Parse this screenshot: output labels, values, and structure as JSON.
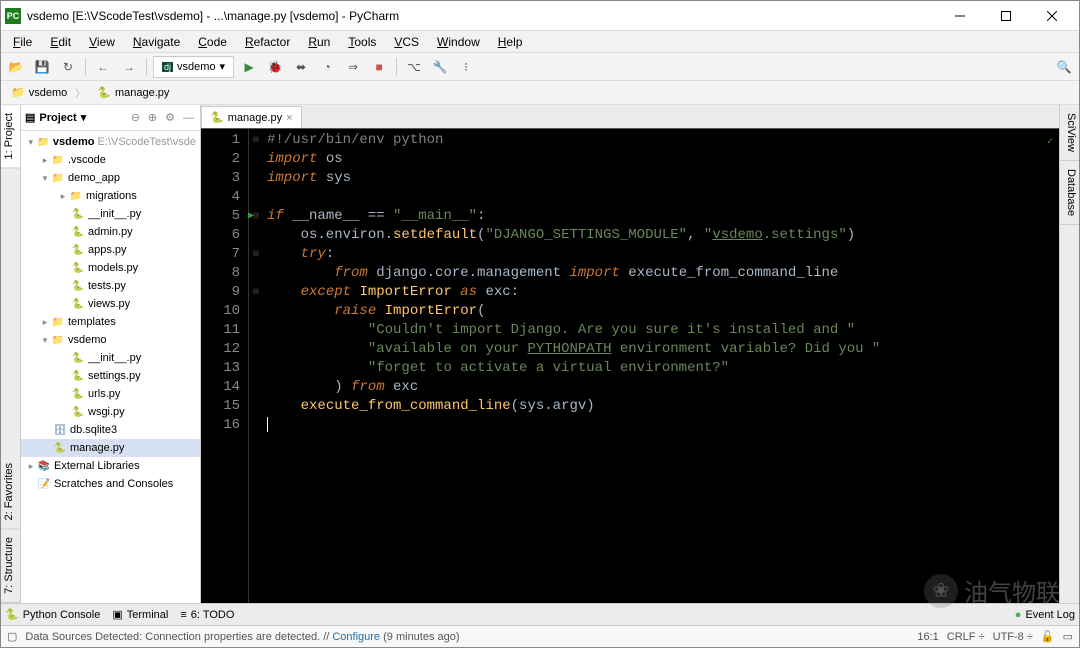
{
  "window": {
    "title": "vsdemo [E:\\VScodeTest\\vsdemo] - ...\\manage.py [vsdemo] - PyCharm",
    "app_short": "PC"
  },
  "menu": [
    "File",
    "Edit",
    "View",
    "Navigate",
    "Code",
    "Refactor",
    "Run",
    "Tools",
    "VCS",
    "Window",
    "Help"
  ],
  "toolbar": {
    "config": "vsdemo"
  },
  "breadcrumb": [
    "vsdemo",
    "manage.py"
  ],
  "side_tabs_left": [
    "1: Project",
    "2: Favorites",
    "7: Structure"
  ],
  "side_tabs_right": [
    "SciView",
    "Database"
  ],
  "project_pane": {
    "title": "Project"
  },
  "tree": {
    "root": {
      "label": "vsdemo",
      "path": "E:\\VScodeTest\\vsde"
    },
    "vscode": ".vscode",
    "demo_app": "demo_app",
    "migrations": "migrations",
    "init": "__init__.py",
    "admin": "admin.py",
    "apps": "apps.py",
    "models": "models.py",
    "tests": "tests.py",
    "views": "views.py",
    "templates": "templates",
    "vsdemo_pkg": "vsdemo",
    "init2": "__init__.py",
    "settings": "settings.py",
    "urls": "urls.py",
    "wsgi": "wsgi.py",
    "db": "db.sqlite3",
    "manage": "manage.py",
    "external": "External Libraries",
    "scratches": "Scratches and Consoles"
  },
  "editor": {
    "tab": "manage.py",
    "lines": [
      {
        "n": 1,
        "html": "<span class='cm'>#!/usr/bin/env python</span>"
      },
      {
        "n": 2,
        "html": "<span class='kw'>import</span> os"
      },
      {
        "n": 3,
        "html": "<span class='kw'>import</span> sys"
      },
      {
        "n": 4,
        "html": ""
      },
      {
        "n": 5,
        "run": true,
        "html": "<span class='kw'>if</span> __name__ == <span class='str'>\"__main__\"</span>:"
      },
      {
        "n": 6,
        "html": "    os.environ.<span class='fn'>setdefault</span>(<span class='str'>\"DJANGO_SETTINGS_MODULE\"</span>, <span class='str'>\"<span class='ul'>vsdemo</span>.settings\"</span>)"
      },
      {
        "n": 7,
        "html": "    <span class='kw'>try</span>:"
      },
      {
        "n": 8,
        "html": "        <span class='kw'>from</span> django.core.management <span class='kw'>import</span> execute_from_command_line"
      },
      {
        "n": 9,
        "html": "    <span class='kw'>except</span> <span class='fn'>ImportError</span> <span class='kw'>as</span> exc:"
      },
      {
        "n": 10,
        "html": "        <span class='kw'>raise</span> <span class='fn'>ImportError</span>("
      },
      {
        "n": 11,
        "html": "            <span class='str'>\"Couldn't import Django. Are you sure it's installed and \"</span>"
      },
      {
        "n": 12,
        "html": "            <span class='str'>\"available on your <span class='ul'>PYTHONPATH</span> environment variable? Did you \"</span>"
      },
      {
        "n": 13,
        "html": "            <span class='str'>\"forget to activate a virtual environment?\"</span>"
      },
      {
        "n": 14,
        "html": "        ) <span class='kw'>from</span> exc"
      },
      {
        "n": 15,
        "html": "    <span class='fn'>execute_from_command_line</span>(sys.argv)"
      },
      {
        "n": 16,
        "html": "<span class='caret'></span>"
      }
    ]
  },
  "bottom_tabs": {
    "python_console": "Python Console",
    "terminal": "Terminal",
    "todo": "6: TODO",
    "event_log": "Event Log"
  },
  "status": {
    "message_pre": "Data Sources Detected: Connection properties are detected. // ",
    "message_link": "Configure",
    "message_post": " (9 minutes ago)",
    "pos": "16:1",
    "line_sep": "CRLF",
    "encoding": "UTF-8"
  },
  "watermark": "油气物联"
}
